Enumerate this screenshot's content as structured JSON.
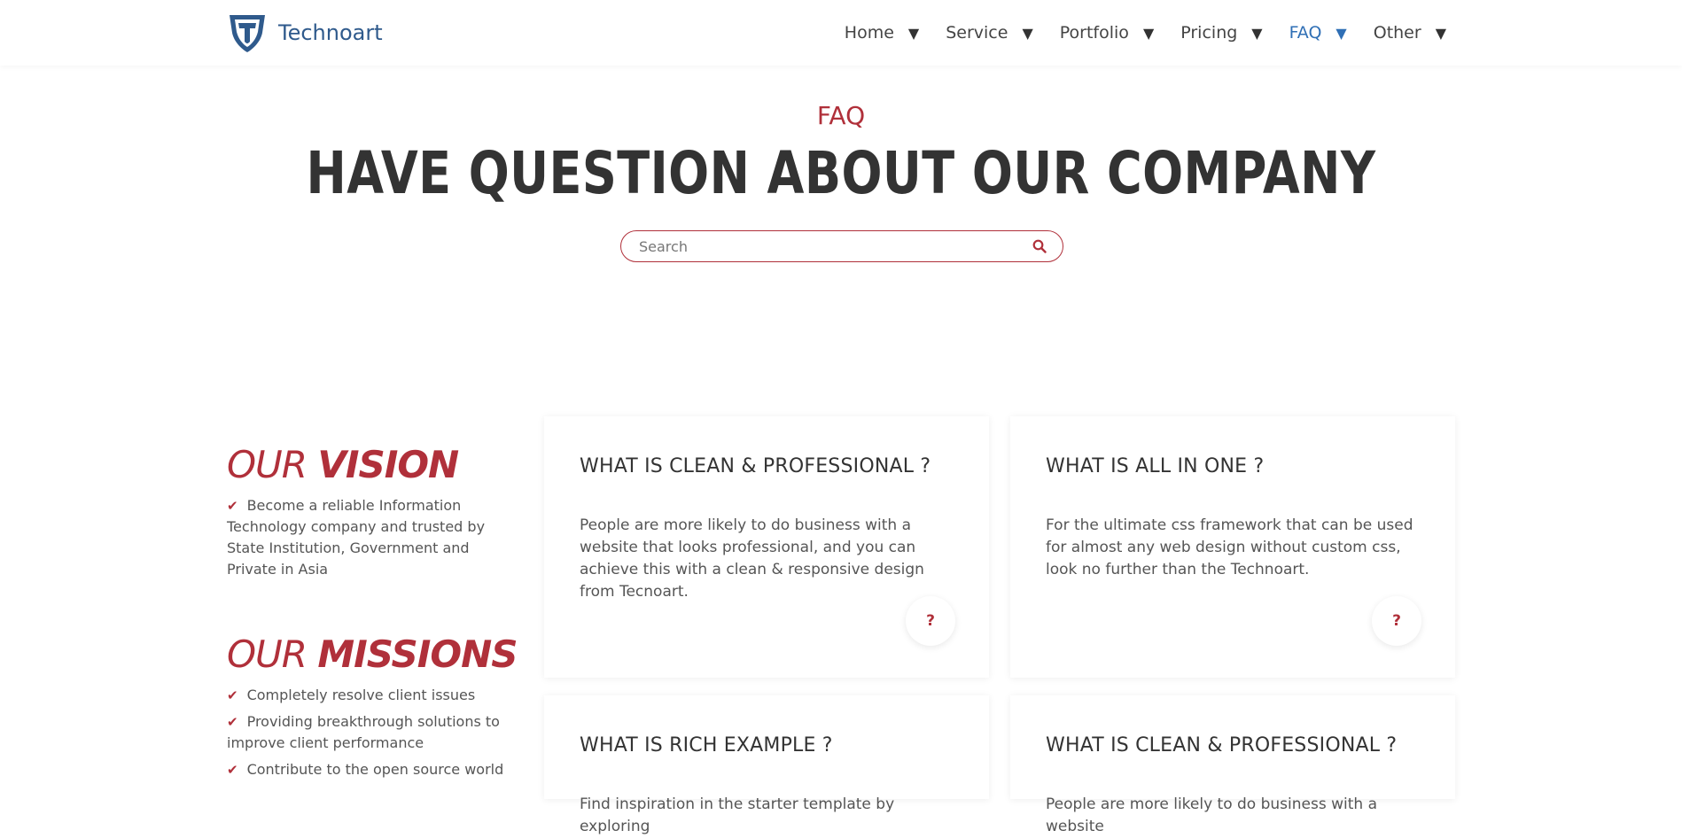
{
  "brand": {
    "name": "Technoart"
  },
  "nav": [
    {
      "label": "Home"
    },
    {
      "label": "Service"
    },
    {
      "label": "Portfolio"
    },
    {
      "label": "Pricing"
    },
    {
      "label": "FAQ",
      "active": true
    },
    {
      "label": "Other"
    }
  ],
  "hero": {
    "eyebrow": "FAQ",
    "title": "HAVE QUESTION ABOUT OUR COMPANY",
    "search_placeholder": "Search"
  },
  "vision": {
    "title_light": "OUR",
    "title_bold": "VISION",
    "items": [
      "Become a reliable Information Technology company and trusted by State Institution, Government and Private in Asia"
    ]
  },
  "missions": {
    "title_light": "OUR",
    "title_bold": "MISSIONS",
    "items": [
      "Completely resolve client issues",
      "Providing breakthrough solutions to improve client performance",
      "Contribute to the open source world"
    ]
  },
  "faq_cards": [
    {
      "title": "WHAT IS CLEAN & PROFESSIONAL ?",
      "body": "People are more likely to do business with a website that looks professional, and you can achieve this with a clean & responsive design from Tecnoart.",
      "badge": "?"
    },
    {
      "title": "WHAT IS ALL IN ONE ?",
      "body": "For the ultimate css framework that can be used for almost any web design without custom css, look no further than the Technoart.",
      "badge": "?"
    },
    {
      "title": "WHAT IS RICH EXAMPLE ?",
      "body": "Find inspiration in the starter template by exploring",
      "badge": "?"
    },
    {
      "title": "WHAT IS CLEAN & PROFESSIONAL ?",
      "body": "People are more likely to do business with a website",
      "badge": "?"
    }
  ],
  "colors": {
    "accent": "#b0303a",
    "brand": "#2f5a8c",
    "nav_active": "#2f6fb5",
    "heading": "#333333"
  },
  "icons": {
    "logo": "shield-t-logo",
    "search": "search-icon",
    "check": "check-icon",
    "caret": "caret-down-icon"
  }
}
